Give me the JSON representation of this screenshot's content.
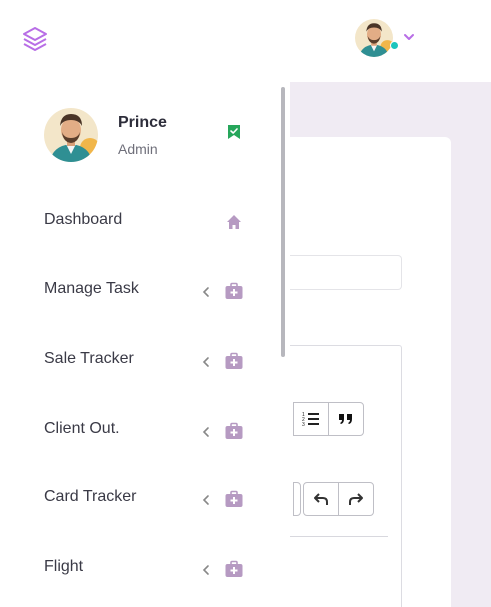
{
  "header": {
    "logo_icon": "layers-icon",
    "avatar_icon": "user-avatar",
    "chevron_icon": "chevron-down-icon",
    "accent_color": "#b86ee6"
  },
  "profile": {
    "name": "Prince",
    "role": "Admin",
    "badge_icon": "verified-bookmark-icon",
    "badge_color": "#26a65b"
  },
  "sidebar": {
    "items": [
      {
        "label": "Dashboard",
        "icon": "home-icon",
        "has_submenu": false
      },
      {
        "label": "Manage Task",
        "icon": "briefcase-plus-icon",
        "has_submenu": true
      },
      {
        "label": "Sale Tracker",
        "icon": "briefcase-plus-icon",
        "has_submenu": true
      },
      {
        "label": "Client Out.",
        "icon": "briefcase-plus-icon",
        "has_submenu": true
      },
      {
        "label": "Card Tracker",
        "icon": "briefcase-plus-icon",
        "has_submenu": true
      },
      {
        "label": "Flight",
        "icon": "briefcase-plus-icon",
        "has_submenu": true
      }
    ],
    "icon_color": "#b69ac2"
  },
  "editor": {
    "toolbar_icons": [
      "ordered-list-icon",
      "blockquote-icon",
      "undo-icon",
      "redo-icon"
    ]
  }
}
